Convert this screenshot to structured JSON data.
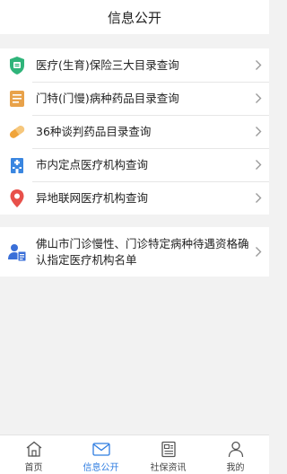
{
  "header": {
    "title": "信息公开"
  },
  "group1": {
    "items": [
      {
        "label": "医疗(生育)保险三大目录查询",
        "icon": "shield-insurance-icon"
      },
      {
        "label": "门特(门慢)病种药品目录查询",
        "icon": "document-list-icon"
      },
      {
        "label": "36种谈判药品目录查询",
        "icon": "pill-capsule-icon"
      },
      {
        "label": "市内定点医疗机构查询",
        "icon": "hospital-building-icon"
      },
      {
        "label": "异地联网医疗机构查询",
        "icon": "location-pin-icon"
      }
    ]
  },
  "group2": {
    "items": [
      {
        "label": "佛山市门诊慢性、门诊特定病种待遇资格确认指定医疗机构名单",
        "icon": "person-document-icon"
      }
    ]
  },
  "tabbar": {
    "tabs": [
      {
        "label": "首页",
        "icon": "home-icon"
      },
      {
        "label": "信息公开",
        "icon": "mail-icon"
      },
      {
        "label": "社保资讯",
        "icon": "news-icon"
      },
      {
        "label": "我的",
        "icon": "user-icon"
      }
    ],
    "active_index": 1
  },
  "colors": {
    "accent": "#2f7de1",
    "shield_green": "#2fb47a",
    "doc_orange": "#e8a24a",
    "pill_orange": "#f0a43a",
    "building_blue": "#3a86e0",
    "pin_red": "#e8504a",
    "person_blue": "#3a6fd8"
  }
}
